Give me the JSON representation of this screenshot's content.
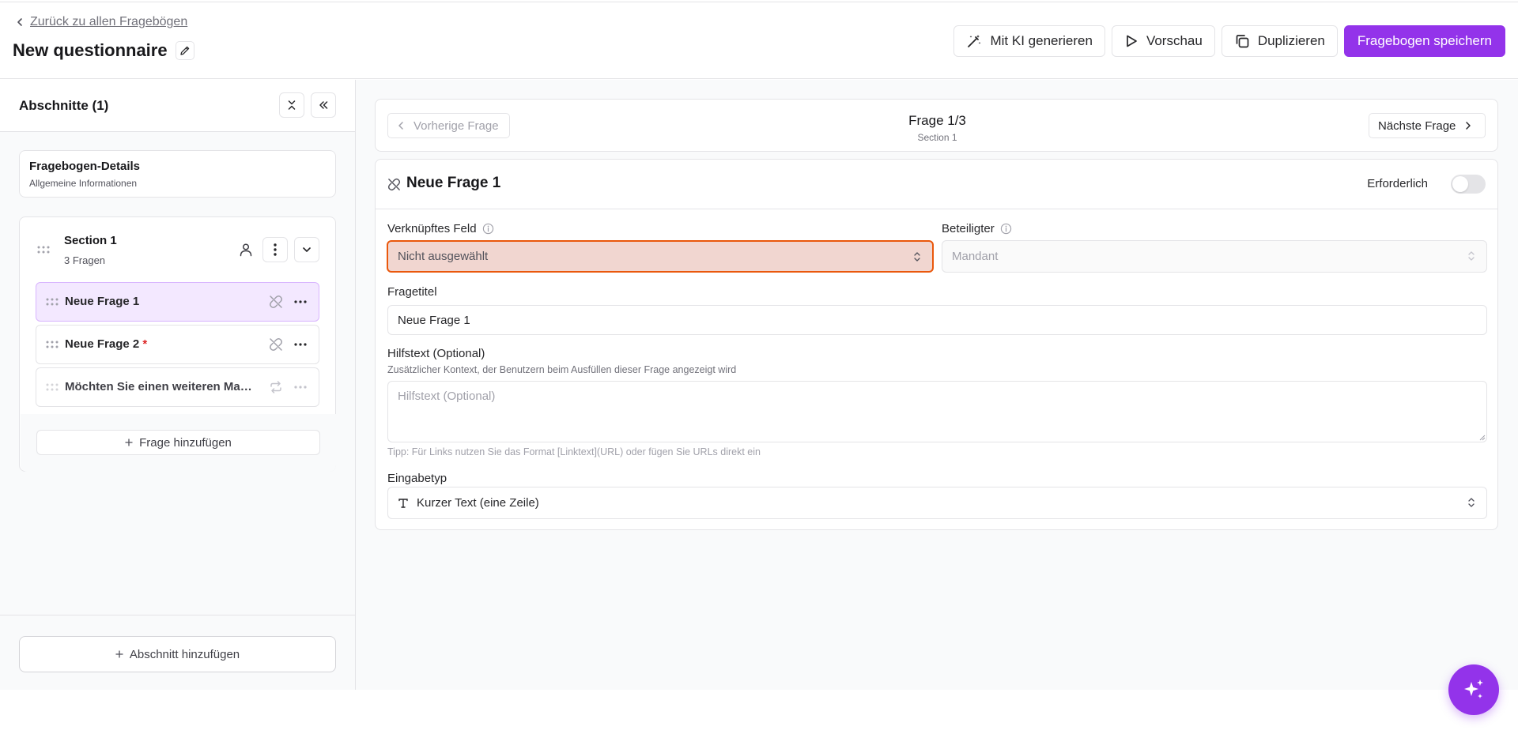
{
  "header": {
    "back_label": "Zurück zu allen Fragebögen",
    "title": "New questionnaire",
    "actions": {
      "ai": "Mit KI generieren",
      "preview": "Vorschau",
      "duplicate": "Duplizieren",
      "save": "Fragebogen speichern"
    }
  },
  "sidebar": {
    "title": "Abschnitte (1)",
    "details": {
      "title": "Fragebogen-Details",
      "subtitle": "Allgemeine Informationen"
    },
    "section": {
      "name": "Section 1",
      "count": "3 Fragen",
      "questions": [
        {
          "label": "Neue Frage 1",
          "required": ""
        },
        {
          "label": "Neue Frage 2",
          "required": "*"
        },
        {
          "label": "Möchten Sie einen weiteren Mandanten hinzufügen?",
          "required": ""
        }
      ],
      "add_question": "Frage hinzufügen"
    },
    "add_section": "Abschnitt hinzufügen"
  },
  "nav": {
    "prev": "Vorherige Frage",
    "next": "Nächste Frage",
    "question": "Frage 1/3",
    "section": "Section 1"
  },
  "question": {
    "title": "Neue Frage 1",
    "required_label": "Erforderlich",
    "required_on": false,
    "linked_field": {
      "label": "Verknüpftes Feld",
      "value": "Nicht ausgewählt"
    },
    "participant": {
      "label": "Beteiligter",
      "value": "Mandant"
    },
    "question_title": {
      "label": "Fragetitel",
      "value": "Neue Frage 1"
    },
    "help_text": {
      "label": "Hilfstext (Optional)",
      "description": "Zusätzlicher Kontext, der Benutzern beim Ausfüllen dieser Frage angezeigt wird",
      "placeholder": "Hilfstext (Optional)",
      "tip": "Tipp: Für Links nutzen Sie das Format [Linktext](URL) oder fügen Sie URLs direkt ein"
    },
    "input_type": {
      "label": "Eingabetyp",
      "value": "Kurzer Text (eine Zeile)"
    }
  },
  "colors": {
    "accent": "#9333ea",
    "error_border": "#ea580c",
    "error_fill": "#f1d6d0",
    "active_item": "#f3e8ff"
  }
}
